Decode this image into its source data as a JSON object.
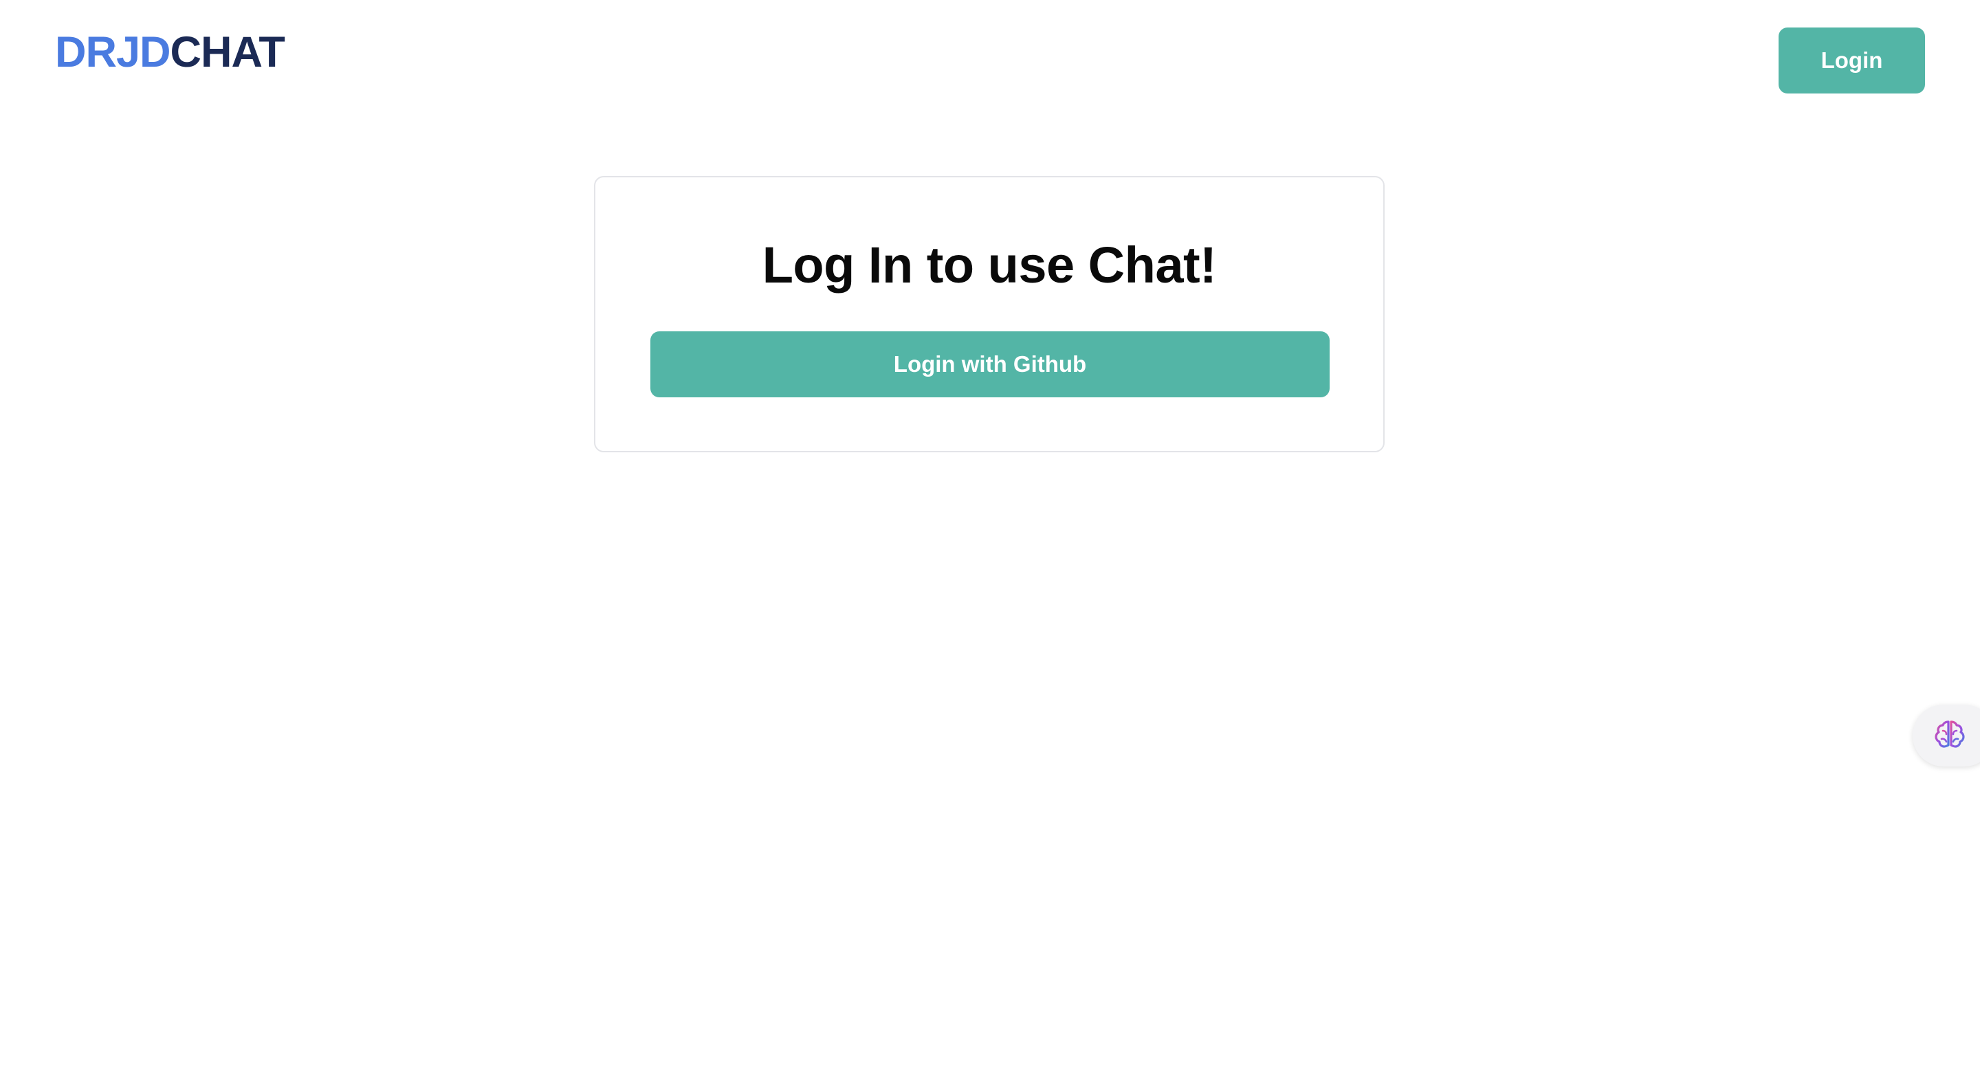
{
  "header": {
    "logo_part_a": "DRJD",
    "logo_part_b": "CHAT",
    "login_label": "Login"
  },
  "card": {
    "title": "Log In to use Chat!",
    "github_button_label": "Login with Github"
  },
  "side_widget": {
    "icon": "brain-icon"
  },
  "colors": {
    "accent": "#53b5a6",
    "logo_blue": "#4a7be0",
    "logo_navy": "#1b2a55",
    "card_border": "#e3e4e8"
  }
}
